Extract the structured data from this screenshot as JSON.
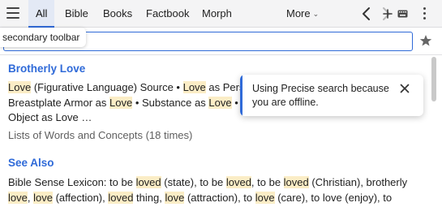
{
  "topbar": {
    "tabs": [
      {
        "label": "All",
        "active": true
      },
      {
        "label": "Bible"
      },
      {
        "label": "Books"
      },
      {
        "label": "Factbook"
      },
      {
        "label": "Morph"
      }
    ],
    "more_label": "More",
    "icons": [
      "menu-icon",
      "chevron-down-icon",
      "chevron-left-icon",
      "chevron-right-icon",
      "more-vertical-icon"
    ]
  },
  "tooltip": {
    "text": "secondary toolbar"
  },
  "search": {
    "value": "",
    "icons": [
      "plus-icon",
      "keyboard-icon",
      "star-icon"
    ]
  },
  "notice": {
    "text": "Using Precise search because you are offline.",
    "accent": "#2f6ad8"
  },
  "results": {
    "brotherly": {
      "title": "Brotherly Love",
      "line1": [
        {
          "t": "Love",
          "h": true
        },
        {
          "t": " (Figurative Language) Source • "
        },
        {
          "t": "Love",
          "h": true
        },
        {
          "t": " as Perso"
        }
      ],
      "line2": [
        {
          "t": "Breastplate Armor as "
        },
        {
          "t": "Love",
          "h": true
        },
        {
          "t": " • Substance as "
        },
        {
          "t": "Love",
          "h": true
        },
        {
          "t": " • W"
        }
      ],
      "line3": [
        {
          "t": "Object as Love …"
        }
      ],
      "meta": "Lists of Words and Concepts (18 times)"
    },
    "see_also": {
      "title": "See Also",
      "line1": [
        {
          "t": "Bible Sense Lexicon: to be "
        },
        {
          "t": "loved",
          "h": true
        },
        {
          "t": " (state), to be "
        },
        {
          "t": "loved",
          "h": true
        },
        {
          "t": ", to be "
        },
        {
          "t": "loved",
          "h": true
        },
        {
          "t": " (Christian), brotherly"
        }
      ],
      "line2": [
        {
          "t": "love",
          "h": true
        },
        {
          "t": ", "
        },
        {
          "t": "love",
          "h": true
        },
        {
          "t": " (affection), "
        },
        {
          "t": "loved",
          "h": true
        },
        {
          "t": " thing, "
        },
        {
          "t": "love",
          "h": true
        },
        {
          "t": " (attraction), to "
        },
        {
          "t": "love",
          "h": true
        },
        {
          "t": " (care), to love (enjoy), to"
        }
      ]
    }
  },
  "colors": {
    "accent": "#2f6ad8",
    "highlight": "#fbedc6",
    "toolbar_bg": "#f4f4f5"
  }
}
